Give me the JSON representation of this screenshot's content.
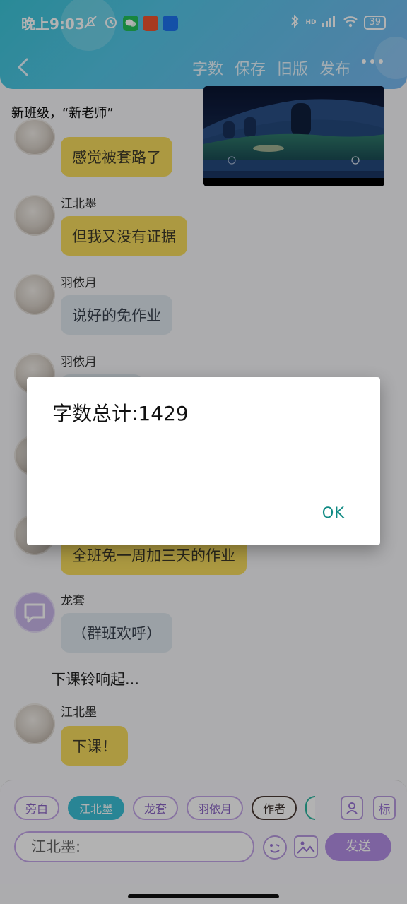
{
  "status_bar": {
    "time": "晚上9:03",
    "network": "HD",
    "battery": "39"
  },
  "header": {
    "actions": [
      "字数",
      "保存",
      "旧版",
      "发布"
    ]
  },
  "chat": {
    "title_line": "新班级，“新老师”",
    "messages": [
      {
        "name": "",
        "text": "感觉被套路了",
        "style": "yellow"
      },
      {
        "name": "江北墨",
        "text": "但我又没有证据",
        "style": "yellow"
      },
      {
        "name": "羽依月",
        "text": "说好的免作业",
        "style": "gray"
      },
      {
        "name": "羽依月",
        "text": "",
        "style": "gray"
      },
      {
        "name": "",
        "text": "全班免一周加三天的作业",
        "style": "yellow"
      },
      {
        "name": "龙套",
        "text": "（群班欢呼）",
        "style": "gray"
      },
      {
        "name": "江北墨",
        "text": "下课！",
        "style": "yellow"
      }
    ],
    "narration": "下课铃响起..."
  },
  "bottom": {
    "chips": [
      {
        "label": "旁白"
      },
      {
        "label": "江北墨"
      },
      {
        "label": "龙套"
      },
      {
        "label": "羽依月"
      },
      {
        "label": "作者"
      }
    ],
    "tools": [
      "person-card-icon",
      "标"
    ],
    "input_value": "江北墨:",
    "send_label": "发送"
  },
  "dialog": {
    "title": "字数总计:1429",
    "ok_label": "OK"
  },
  "colors": {
    "header_accent": "#3cc6d9",
    "bubble_yellow": "#f6dc5e",
    "bubble_gray": "#dfe7ee",
    "chip_active": "#3bbfd6",
    "send_button": "#b48ee6",
    "dialog_ok": "#0f8a83"
  }
}
